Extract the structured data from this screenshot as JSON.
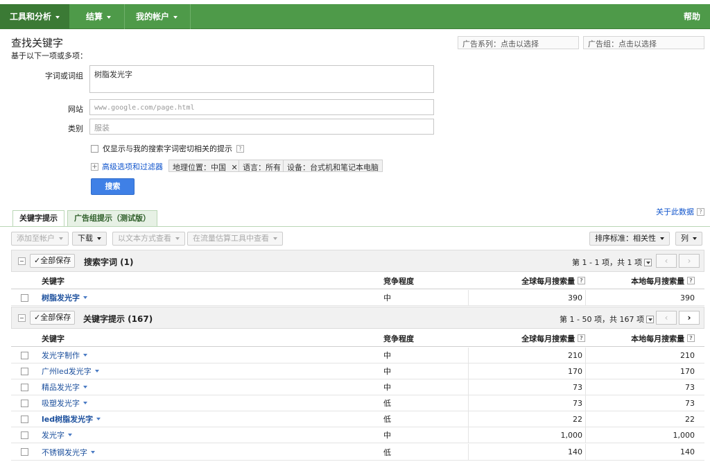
{
  "nav": {
    "tools": "工具和分析",
    "billing": "结算",
    "account": "我的帐户",
    "help": "帮助"
  },
  "form": {
    "title": "查找关键字",
    "subtitle": "基于以下一项或多项：",
    "word_label": "字词或词组",
    "word_value": "树脂发光字",
    "website_label": "网站",
    "website_placeholder": "www.google.com/page.html",
    "category_label": "类别",
    "category_placeholder": "服装",
    "campaign_select": "广告系列：点击以选择",
    "adgroup_select": "广告组：点击以选择",
    "only_related": "仅显示与我的搜索字词密切相关的提示",
    "advanced": "高级选项和过滤器",
    "chips": [
      "地理位置：中国",
      "语言：所有",
      "设备：台式机和笔记本电脑"
    ],
    "search_button": "搜索"
  },
  "tabs": {
    "keyword_ideas": "关键字提示",
    "adgroup_ideas": "广告组提示（测试版）",
    "about_data": "关于此数据"
  },
  "toolbar": {
    "add_to_account": "添加至帐户",
    "download": "下载",
    "view_as_text": "以文本方式查看",
    "traffic_estimator": "在流量估算工具中查看",
    "sort_by": "排序标准：相关性",
    "columns": "列"
  },
  "columns": {
    "keyword": "关键字",
    "competition": "竞争程度",
    "global": "全球每月搜索量",
    "local": "本地每月搜索量"
  },
  "search_terms": {
    "save_all": "✓全部保存",
    "title": "搜索字词 (1)",
    "pagination": "第 1 - 1 项，共 1 项",
    "rows": [
      {
        "keyword": "树脂发光字",
        "competition": "中",
        "global": "390",
        "local": "390"
      }
    ]
  },
  "keyword_ideas": {
    "save_all": "✓全部保存",
    "title": "关键字提示 (167)",
    "pagination": "第 1 - 50 项，共 167 项",
    "rows": [
      {
        "keyword": "发光字制作",
        "competition": "中",
        "global": "210",
        "local": "210"
      },
      {
        "keyword": "广州led发光字",
        "competition": "中",
        "global": "170",
        "local": "170"
      },
      {
        "keyword": "精品发光字",
        "competition": "中",
        "global": "73",
        "local": "73"
      },
      {
        "keyword": "吸塑发光字",
        "competition": "低",
        "global": "73",
        "local": "73"
      },
      {
        "keyword": "led树脂发光字",
        "competition": "低",
        "global": "22",
        "local": "22"
      },
      {
        "keyword": "发光字",
        "competition": "中",
        "global": "1,000",
        "local": "1,000"
      },
      {
        "keyword": "不锈钢发光字",
        "competition": "低",
        "global": "140",
        "local": "140"
      }
    ]
  }
}
